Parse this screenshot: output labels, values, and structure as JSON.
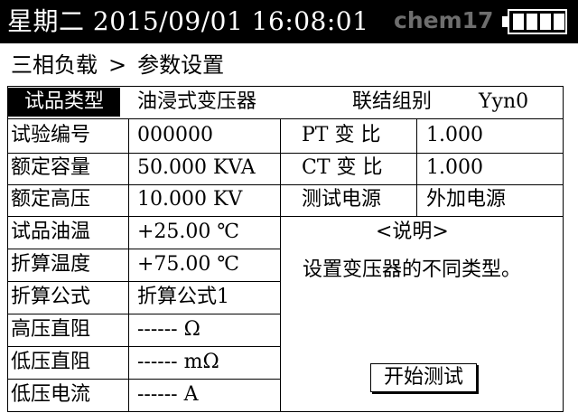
{
  "status_bar": {
    "datetime": "星期二 2015/09/01  16:08:01",
    "watermark": "chem17",
    "battery_level": 1.0
  },
  "breadcrumb": {
    "parent": "三相负载",
    "separator": ">",
    "current": "参数设置"
  },
  "form": {
    "product_type": {
      "label": "试品类型",
      "value": "油浸式变压器"
    },
    "connection_group": {
      "label": "联结组别",
      "value": "Yyn0"
    },
    "rows": [
      {
        "label": "试验编号",
        "value": "000000"
      },
      {
        "label": "额定容量",
        "value": "50.000 KVA"
      },
      {
        "label": "额定高压",
        "value": "10.000 KV"
      },
      {
        "label": "试品油温",
        "value": "+25.00 ℃"
      },
      {
        "label": "折算温度",
        "value": "+75.00 ℃"
      },
      {
        "label": "折算公式",
        "value": "折算公式1"
      },
      {
        "label": "高压直阻",
        "value": "------ Ω"
      },
      {
        "label": "低压直阻",
        "value": "------ mΩ"
      },
      {
        "label": "低压电流",
        "value": "------ A"
      }
    ],
    "right_rows": [
      {
        "label": "PT 变 比",
        "value": "1.000"
      },
      {
        "label": "CT 变 比",
        "value": "1.000"
      },
      {
        "label": "测试电源",
        "value": "外加电源"
      }
    ]
  },
  "note": {
    "title": "<说明>",
    "text": "设置变压器的不同类型。"
  },
  "start_button": "开始测试"
}
